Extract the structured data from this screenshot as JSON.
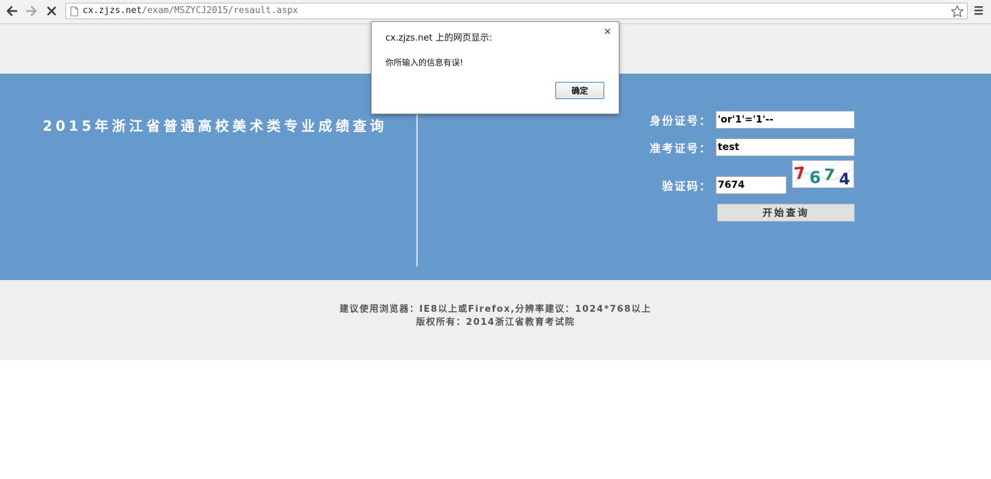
{
  "browser": {
    "url_host": "cx.zjzs.net",
    "url_path": "/exam/MSZYCJ2015/resault.aspx",
    "icons": [
      "back-icon",
      "forward-icon",
      "stop-icon",
      "page-icon",
      "star-icon",
      "menu-icon"
    ]
  },
  "page": {
    "title": "2015年浙江省普通高校美术类专业成绩查询",
    "form": {
      "id_label": "身份证号：",
      "id_value": "'or'1'='1'--",
      "exam_label": "准考证号：",
      "exam_value": "test",
      "captcha_label": "验证码：",
      "captcha_value": "7674",
      "captcha_image_text": "7674",
      "submit_label": "开始查询"
    },
    "footer": {
      "line1": "建议使用浏览器：IE8以上或Firefox,分辨率建议：1024*768以上",
      "line2": "版权所有：2014浙江省教育考试院"
    },
    "colors": {
      "main_band": "#6699cc",
      "bands": "#efefef"
    }
  },
  "dialog": {
    "title": "cx.zjzs.net 上的网页显示:",
    "message": "你所输入的信息有误!",
    "ok_label": "确定",
    "close_glyph": "×"
  }
}
